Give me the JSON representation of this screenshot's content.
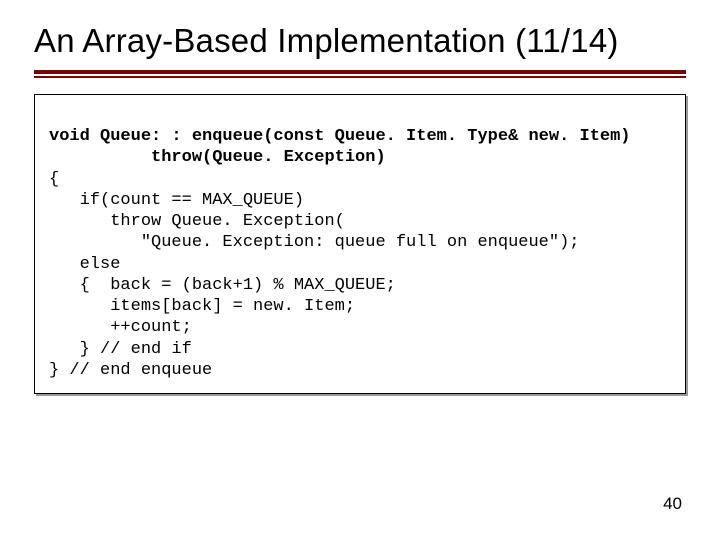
{
  "title": "An Array-Based Implementation (11/14)",
  "code": {
    "l1": "void Queue: : enqueue(const Queue. Item. Type& new. Item)",
    "l2": "          throw(Queue. Exception)",
    "l3": "{",
    "l4": "   if(count == MAX_QUEUE)",
    "l5": "      throw Queue. Exception(",
    "l6": "         \"Queue. Exception: queue full on enqueue\");",
    "l7": "   else",
    "l8": "   {  back = (back+1) % MAX_QUEUE;",
    "l9": "      items[back] = new. Item;",
    "l10": "      ++count;",
    "l11": "   } // end if",
    "l12": "} // end enqueue"
  },
  "page_number": "40"
}
